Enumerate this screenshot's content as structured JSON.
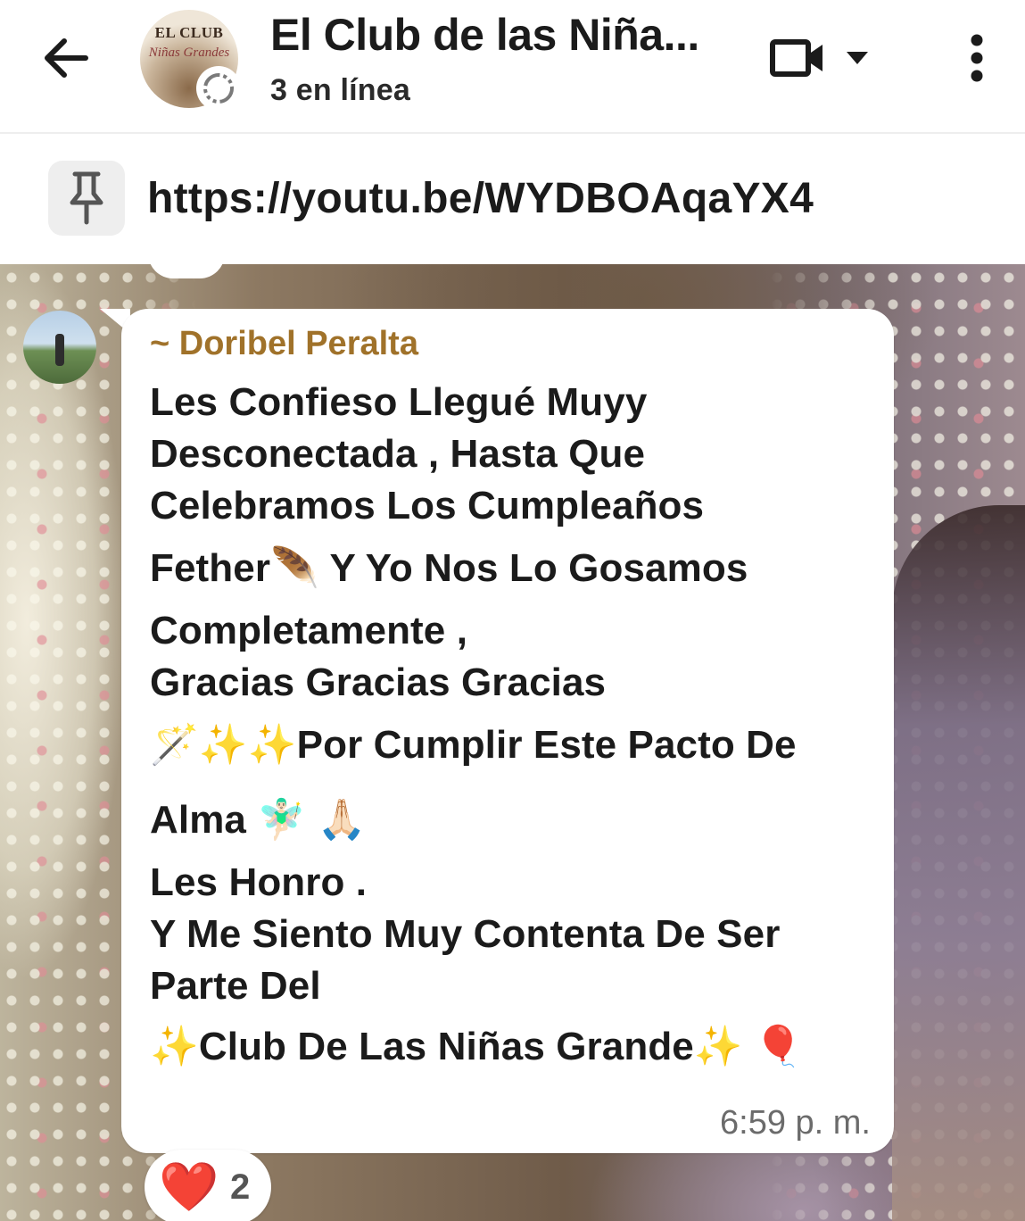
{
  "header": {
    "back_icon": "arrow-left-icon",
    "avatar_logo_line1": "EL CLUB",
    "avatar_logo_line2": "Niñas Grandes",
    "title": "El Club de las Niña...",
    "subtitle": "3 en línea",
    "video_icon": "video-camera-icon",
    "video_dropdown_icon": "caret-down-icon",
    "menu_icon": "more-vertical-icon"
  },
  "pinned": {
    "icon": "pin-icon",
    "text": "https://youtu.be/WYDBOAqaYX4"
  },
  "message": {
    "sender": "~ Doribel Peralta",
    "lines": [
      "Les Confieso Llegué Muyy",
      "Desconectada , Hasta Que",
      "Celebramos Los Cumpleaños",
      "Fether🪶  Y Yo Nos Lo Gosamos",
      "Completamente ,",
      "Gracias Gracias Gracias",
      "🪄✨✨Por Cumplir Este Pacto De",
      "Alma 🧚🏻‍♂️ 🙏🏻",
      "Les Honro .",
      "Y Me Siento Muy Contenta De Ser",
      "Parte Del",
      "✨Club De Las Niñas Grande✨ 🎈"
    ],
    "time": "6:59 p. m."
  },
  "reaction": {
    "emoji": "❤️",
    "count": "2"
  },
  "colors": {
    "sender_name": "#a0722a",
    "text": "#1b1b1b",
    "time": "#6b6b6b"
  }
}
